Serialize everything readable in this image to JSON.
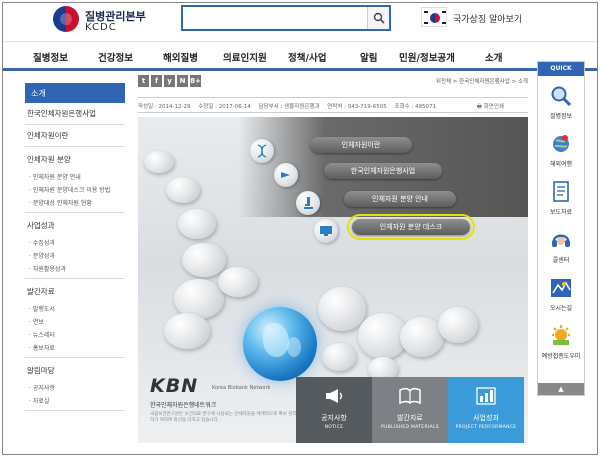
{
  "header": {
    "logo_ko": "질병관리본부",
    "logo_en": "KCDC",
    "search_placeholder": "",
    "symbol_label": "국가상징 알아보기"
  },
  "gnb": [
    "질병정보",
    "건강정보",
    "해외질병",
    "의료인지원",
    "정책/사업",
    "알림",
    "민원/정보공개",
    "소개"
  ],
  "lnb": {
    "head": "소개",
    "rows": [
      {
        "label": "한국인체자원은행사업",
        "subs": []
      },
      {
        "label": "인체자원이란",
        "subs": []
      },
      {
        "label": "인체자원 분양",
        "subs": [
          "인체자원 분양 안내",
          "인체자원 분양데스크 이용 방법",
          "분양대상 인체자원 현황"
        ]
      },
      {
        "label": "사업성과",
        "subs": [
          "수집성과",
          "분양성과",
          "자원활용성과"
        ]
      },
      {
        "label": "발간자료",
        "subs": [
          "발행도서",
          "연보",
          "뉴스레터",
          "홍보자료"
        ]
      },
      {
        "label": "알림마당",
        "subs": [
          "공지사항",
          "자료실"
        ]
      }
    ]
  },
  "content": {
    "sns": [
      "t",
      "f",
      "y",
      "N",
      "8+"
    ],
    "breadcrumb": "위전체 > 한국인체자원은행사업 > 소개",
    "meta": {
      "created": "작성일 : 2014-12-29",
      "modified": "수정일 : 2017-06-14",
      "dept": "담당부서 : 생물자원은행과",
      "phone": "연락처 : 043-719-6505",
      "views": "조회수 : 495071",
      "print": "화면인쇄"
    },
    "menu": [
      "인체자원이란",
      "한국인체자원은행사업",
      "인체자원 분양 안내",
      "인체자원 분양 데스크"
    ],
    "kbn": {
      "logo": "KBN",
      "tagline": "Korea Biobank Network",
      "name": "한국인체자원은행네트워크",
      "desc": "국립보건연구원은 보건의료 연구에 사용되는 인체자원을 체계적으로 확보 관리하기 위하여 최선을 다하고 있습니다."
    },
    "tiles": [
      {
        "ko": "공지사항",
        "en": "NOTICE",
        "color": "#555a5e"
      },
      {
        "ko": "발간자료",
        "en": "PUBLISHED MATERIALS",
        "color": "#7d8186"
      },
      {
        "ko": "사업성과",
        "en": "PROJECT PERFORMANCE",
        "color": "#3b9bd9"
      }
    ]
  },
  "quick": {
    "head": "QUICK",
    "items": [
      "질병정보",
      "해외여행",
      "보도자료",
      "콜센터",
      "오시는길",
      "예방접종도우미"
    ],
    "top": "▲"
  },
  "colors": {
    "primary": "#2f65b4",
    "highlight": "#e7e000",
    "tile_notice": "#555a5e",
    "tile_published": "#7d8186",
    "tile_performance": "#3b9bd9"
  }
}
